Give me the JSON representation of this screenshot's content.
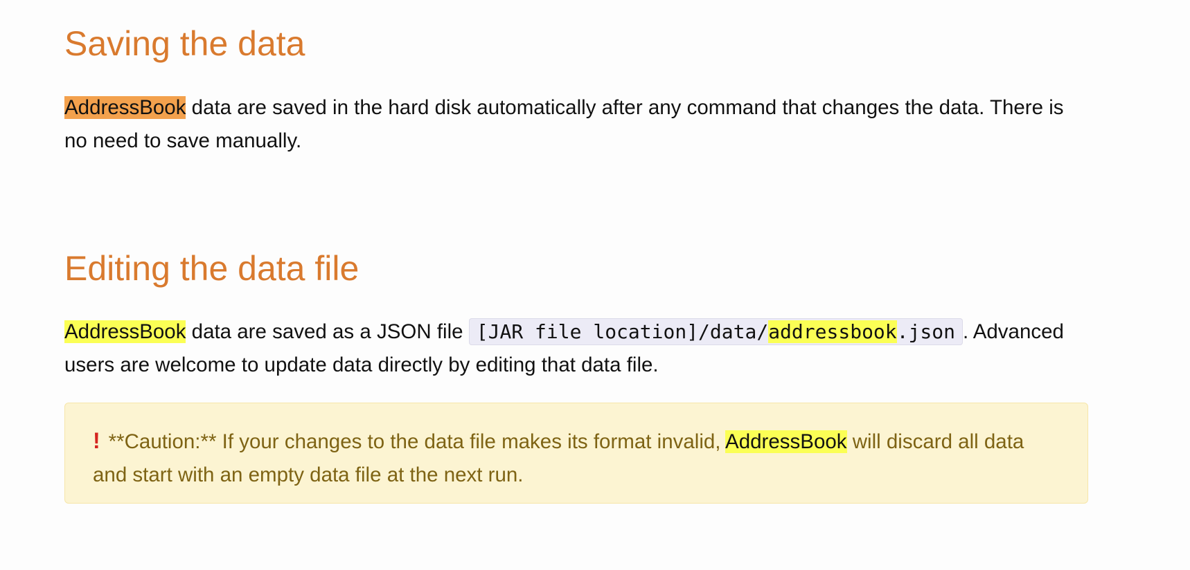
{
  "sections": [
    {
      "title": "Saving the data",
      "paragraph": {
        "highlight": "AddressBook",
        "rest": " data are saved in the hard disk automatically after any command that changes the data. There is no need to save manually."
      }
    },
    {
      "title": "Editing the data file",
      "paragraph": {
        "highlight": "AddressBook",
        "middle": " data are saved as a JSON file ",
        "code_prefix": "[JAR file location]/data/",
        "code_highlight": "addressbook",
        "code_suffix": ".json",
        "end": ". Advanced users are welcome to update data directly by editing that data file."
      },
      "callout": {
        "icon": "exclamation-icon",
        "icon_glyph": "!",
        "text_before": "**Caution:** If your changes to the data file makes its format invalid, ",
        "highlight": "AddressBook",
        "text_after": " will discard all data and start with an empty data file at the next run."
      }
    }
  ],
  "colors": {
    "heading": "#d97a2e",
    "highlight_orange": "#f3a14d",
    "highlight_yellow": "#fbff55",
    "callout_bg": "#fcf4d2",
    "callout_text": "#7e6314",
    "icon": "#d4241f"
  }
}
